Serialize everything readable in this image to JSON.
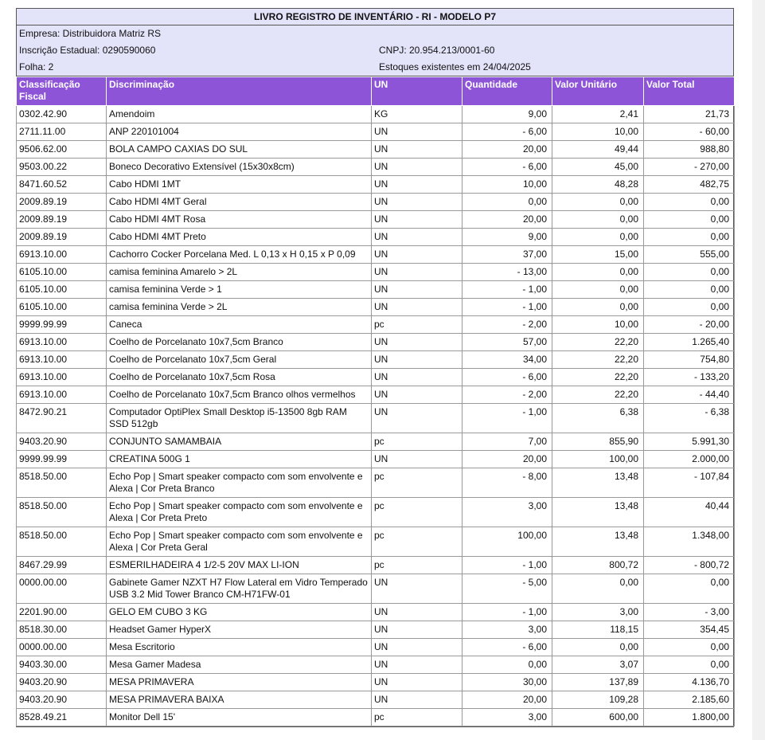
{
  "report": {
    "title": "LIVRO REGISTRO DE INVENTÁRIO - RI - MODELO P7",
    "empresa": "Empresa: Distribuidora Matriz RS",
    "inscricao": "Inscrição Estadual: 0290590060",
    "cnpj": "CNPJ: 20.954.213/0001-60",
    "folha": "Folha: 2",
    "estoques": "Estoques existentes em 24/04/2025"
  },
  "colors": {
    "header_bg": "#8e54d8",
    "info_bg": "#e3e3fa"
  },
  "table": {
    "headers": [
      "Classificação Fiscal",
      "Discriminação",
      "UN",
      "Quantidade",
      "Valor Unitário",
      "Valor Total"
    ],
    "rows": [
      [
        "0302.42.90",
        "Amendoim",
        "KG",
        "9,00",
        "2,41",
        "21,73"
      ],
      [
        "2711.11.00",
        "ANP 220101004",
        "UN",
        "- 6,00",
        "10,00",
        "- 60,00"
      ],
      [
        "9506.62.00",
        "BOLA CAMPO CAXIAS DO SUL",
        "UN",
        "20,00",
        "49,44",
        "988,80"
      ],
      [
        "9503.00.22",
        "Boneco Decorativo Extensível (15x30x8cm)",
        "UN",
        "- 6,00",
        "45,00",
        "- 270,00"
      ],
      [
        "8471.60.52",
        "Cabo HDMI  1MT",
        "UN",
        "10,00",
        "48,28",
        "482,75"
      ],
      [
        "2009.89.19",
        "Cabo HDMI 4MT Geral",
        "UN",
        "0,00",
        "0,00",
        "0,00"
      ],
      [
        "2009.89.19",
        "Cabo HDMI 4MT Rosa",
        "UN",
        "20,00",
        "0,00",
        "0,00"
      ],
      [
        "2009.89.19",
        "Cabo HDMI 4MT Preto",
        "UN",
        "9,00",
        "0,00",
        "0,00"
      ],
      [
        "6913.10.00",
        "Cachorro Cocker Porcelana Med. L 0,13 x H 0,15 x P 0,09",
        "UN",
        "37,00",
        "15,00",
        "555,00"
      ],
      [
        "6105.10.00",
        "camisa feminina Amarelo > 2L",
        "UN",
        "- 13,00",
        "0,00",
        "0,00"
      ],
      [
        "6105.10.00",
        "camisa feminina Verde > 1",
        "UN",
        "- 1,00",
        "0,00",
        "0,00"
      ],
      [
        "6105.10.00",
        "camisa feminina Verde > 2L",
        "UN",
        "- 1,00",
        "0,00",
        "0,00"
      ],
      [
        "9999.99.99",
        "Caneca",
        "pc",
        "- 2,00",
        "10,00",
        "- 20,00"
      ],
      [
        "6913.10.00",
        "Coelho de Porcelanato 10x7,5cm Branco",
        "UN",
        "57,00",
        "22,20",
        "1.265,40"
      ],
      [
        "6913.10.00",
        "Coelho de Porcelanato 10x7,5cm Geral",
        "UN",
        "34,00",
        "22,20",
        "754,80"
      ],
      [
        "6913.10.00",
        "Coelho de Porcelanato 10x7,5cm Rosa",
        "UN",
        "- 6,00",
        "22,20",
        "- 133,20"
      ],
      [
        "6913.10.00",
        "Coelho de Porcelanato 10x7,5cm Branco olhos vermelhos",
        "UN",
        "- 2,00",
        "22,20",
        "- 44,40"
      ],
      [
        "8472.90.21",
        "Computador OptiPlex Small Desktop i5-13500 8gb RAM SSD 512gb",
        "UN",
        "- 1,00",
        "6,38",
        "- 6,38"
      ],
      [
        "9403.20.90",
        "CONJUNTO SAMAMBAIA",
        "pc",
        "7,00",
        "855,90",
        "5.991,30"
      ],
      [
        "9999.99.99",
        "CREATINA 500G 1",
        "UN",
        "20,00",
        "100,00",
        "2.000,00"
      ],
      [
        "8518.50.00",
        "Echo Pop | Smart speaker compacto com som envolvente e Alexa | Cor Preta Branco",
        "pc",
        "- 8,00",
        "13,48",
        "- 107,84"
      ],
      [
        "8518.50.00",
        "Echo Pop | Smart speaker compacto com som envolvente e Alexa | Cor Preta Preto",
        "pc",
        "3,00",
        "13,48",
        "40,44"
      ],
      [
        "8518.50.00",
        "Echo Pop | Smart speaker compacto com som envolvente e Alexa | Cor Preta Geral",
        "pc",
        "100,00",
        "13,48",
        "1.348,00"
      ],
      [
        "8467.29.99",
        "ESMERILHADEIRA 4 1/2-5 20V MAX LI-ION",
        "pc",
        "- 1,00",
        "800,72",
        "- 800,72"
      ],
      [
        "0000.00.00",
        "Gabinete Gamer NZXT H7 Flow Lateral em Vidro Temperado USB 3.2 Mid Tower Branco CM-H71FW-01",
        "UN",
        "- 5,00",
        "0,00",
        "0,00"
      ],
      [
        "2201.90.00",
        "GELO EM CUBO 3 KG",
        "UN",
        "- 1,00",
        "3,00",
        "- 3,00"
      ],
      [
        "8518.30.00",
        "Headset Gamer HyperX",
        "UN",
        "3,00",
        "118,15",
        "354,45"
      ],
      [
        "0000.00.00",
        "Mesa Escritorio",
        "UN",
        "- 6,00",
        "0,00",
        "0,00"
      ],
      [
        "9403.30.00",
        "Mesa Gamer Madesa",
        "UN",
        "0,00",
        "3,07",
        "0,00"
      ],
      [
        "9403.20.90",
        "MESA PRIMAVERA",
        "UN",
        "30,00",
        "137,89",
        "4.136,70"
      ],
      [
        "9403.20.90",
        "MESA PRIMAVERA BAIXA",
        "UN",
        "20,00",
        "109,28",
        "2.185,60"
      ],
      [
        "8528.49.21",
        "Monitor Dell 15'",
        "pc",
        "3,00",
        "600,00",
        "1.800,00"
      ]
    ]
  }
}
